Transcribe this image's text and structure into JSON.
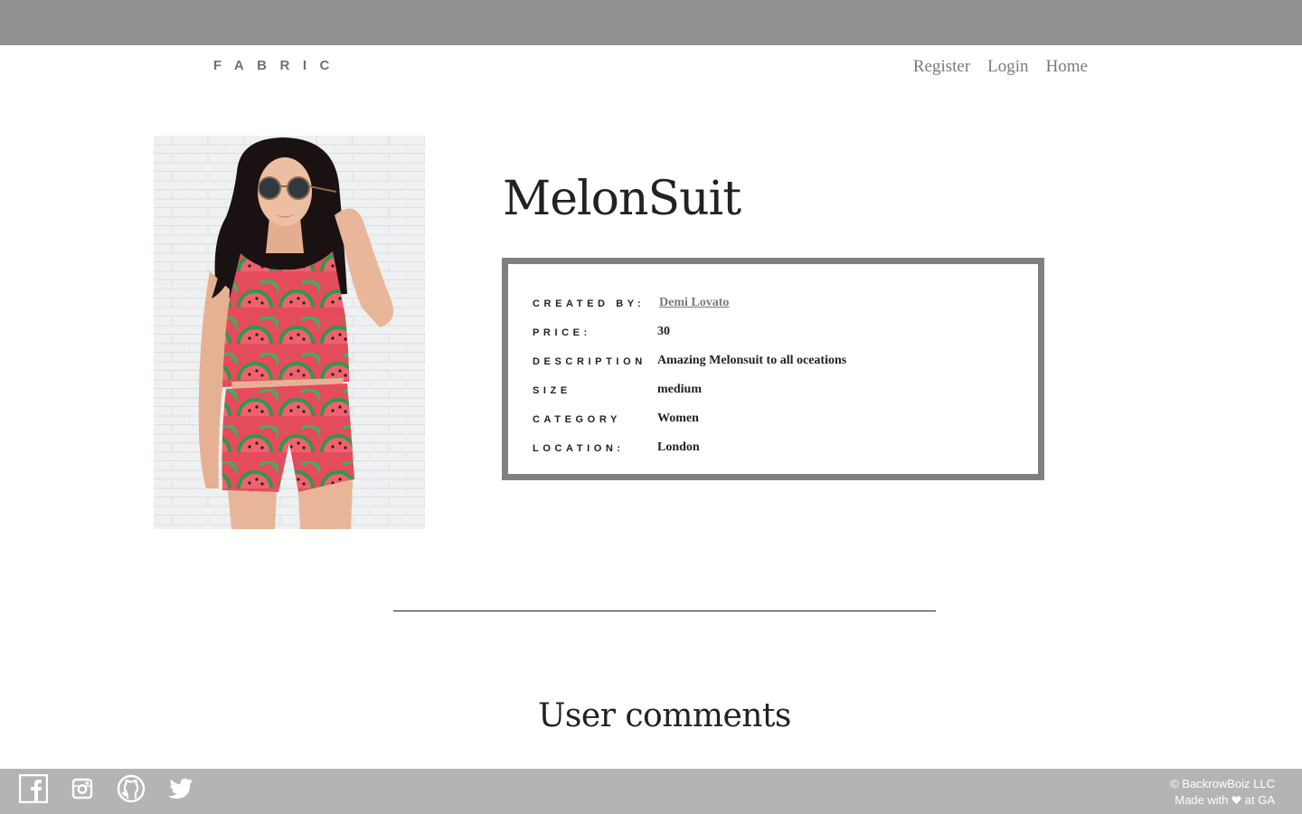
{
  "nav": {
    "brand": "FABRIC",
    "links": [
      {
        "label": "Register"
      },
      {
        "label": "Login"
      },
      {
        "label": "Home"
      }
    ]
  },
  "product": {
    "title": "MelonSuit",
    "details": [
      {
        "label": "CREATED BY:",
        "value": "Demi Lovato"
      },
      {
        "label": "PRICE:",
        "value": "30"
      },
      {
        "label": "DESCRIPTION",
        "value": "Amazing Melonsuit to all oceations"
      },
      {
        "label": "SIZE",
        "value": "medium"
      },
      {
        "label": "CATEGORY",
        "value": "Women"
      },
      {
        "label": "LOCATION:",
        "value": "London"
      }
    ]
  },
  "comments": {
    "heading": "User comments"
  },
  "footer": {
    "social_icons": [
      "facebook-icon",
      "instagram-icon",
      "github-icon",
      "twitter-icon"
    ],
    "copyright_line1": "© BackrowBoiz LLC",
    "copyright_line2_prefix": "Made with",
    "copyright_line2_suffix": "at GA"
  },
  "colors": {
    "topbar": "#929292",
    "footer": "#b4b4b4",
    "box_border": "#808080",
    "muted_text": "#7a7a7a"
  }
}
